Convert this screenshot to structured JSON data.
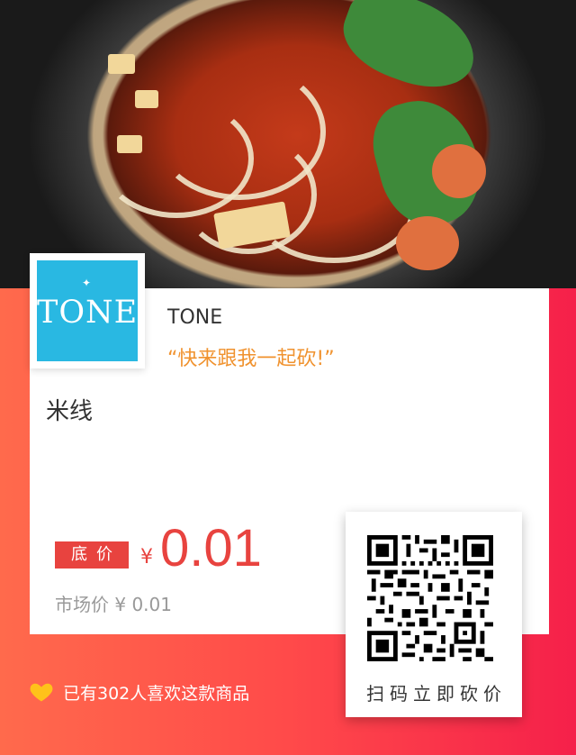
{
  "shop": {
    "name": "TONE",
    "slogan": "“快来跟我一起砍!”",
    "logo_text": "TONE"
  },
  "product": {
    "name": "米线",
    "floor_price_label": "底价",
    "currency": "¥",
    "price": "0.01",
    "market_price": "市场价 ¥ 0.01"
  },
  "qr": {
    "label": "扫码立即砍价"
  },
  "likes": {
    "text": "已有302人喜欢这款商品"
  },
  "colors": {
    "accent": "#e8433f",
    "slogan": "#f0922e",
    "logo_bg": "#29b8e2",
    "heart": "#ffc21a"
  }
}
